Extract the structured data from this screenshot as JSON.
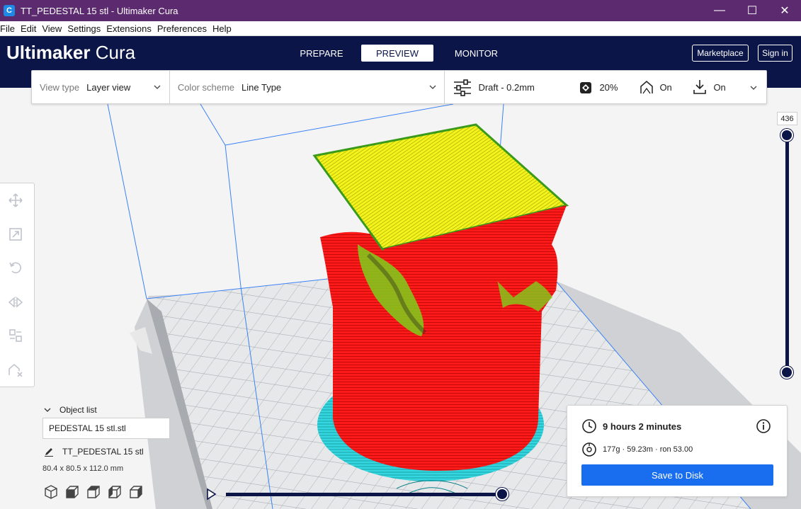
{
  "window": {
    "title": "TT_PEDESTAL 15 stl - Ultimaker Cura",
    "app_icon_letter": "C",
    "minimize_glyph": "—",
    "maximize_glyph": "☐",
    "close_glyph": "✕"
  },
  "menu": [
    "File",
    "Edit",
    "View",
    "Settings",
    "Extensions",
    "Preferences",
    "Help"
  ],
  "header": {
    "brand_bold": "Ultimaker",
    "brand_light": " Cura",
    "tabs": [
      {
        "label": "PREPARE",
        "active": false
      },
      {
        "label": "PREVIEW",
        "active": true
      },
      {
        "label": "MONITOR",
        "active": false
      }
    ],
    "marketplace_label": "Marketplace",
    "signin_label": "Sign in"
  },
  "settings_bar": {
    "view_type_label": "View type",
    "view_type_value": "Layer view",
    "color_scheme_label": "Color scheme",
    "color_scheme_value": "Line Type",
    "profile": "Draft - 0.2mm",
    "infill": "20%",
    "support": "On",
    "adhesion": "On"
  },
  "layer_slider": {
    "current_layer": "436"
  },
  "object_list": {
    "toggle_label": "Object list",
    "selected_item": "PEDESTAL 15 stl.stl",
    "object_name": "TT_PEDESTAL 15 stl",
    "dimensions": "80.4 x 80.5 x 112.0 mm"
  },
  "print_info": {
    "time": "9 hours 2 minutes",
    "material": "177g · 59.23m · ron 53.00",
    "save_label": "Save to Disk"
  },
  "colors": {
    "header_bg": "#0b1548",
    "titlebar_bg": "#5c2a6e",
    "accent_blue": "#196ef0",
    "model_red": "#ff1a1a",
    "model_top_yellow": "#f2f21a",
    "skirt_cyan": "#2fd8e0",
    "build_volume_blue": "#3b82f6"
  },
  "icons": {
    "toolbar": [
      "move-icon",
      "scale-icon",
      "rotate-icon",
      "mirror-icon",
      "per-model-settings-icon",
      "support-blocker-icon"
    ],
    "view_buttons": [
      "3d-view-icon",
      "front-view-icon",
      "top-view-icon",
      "left-view-icon",
      "right-view-icon"
    ]
  }
}
